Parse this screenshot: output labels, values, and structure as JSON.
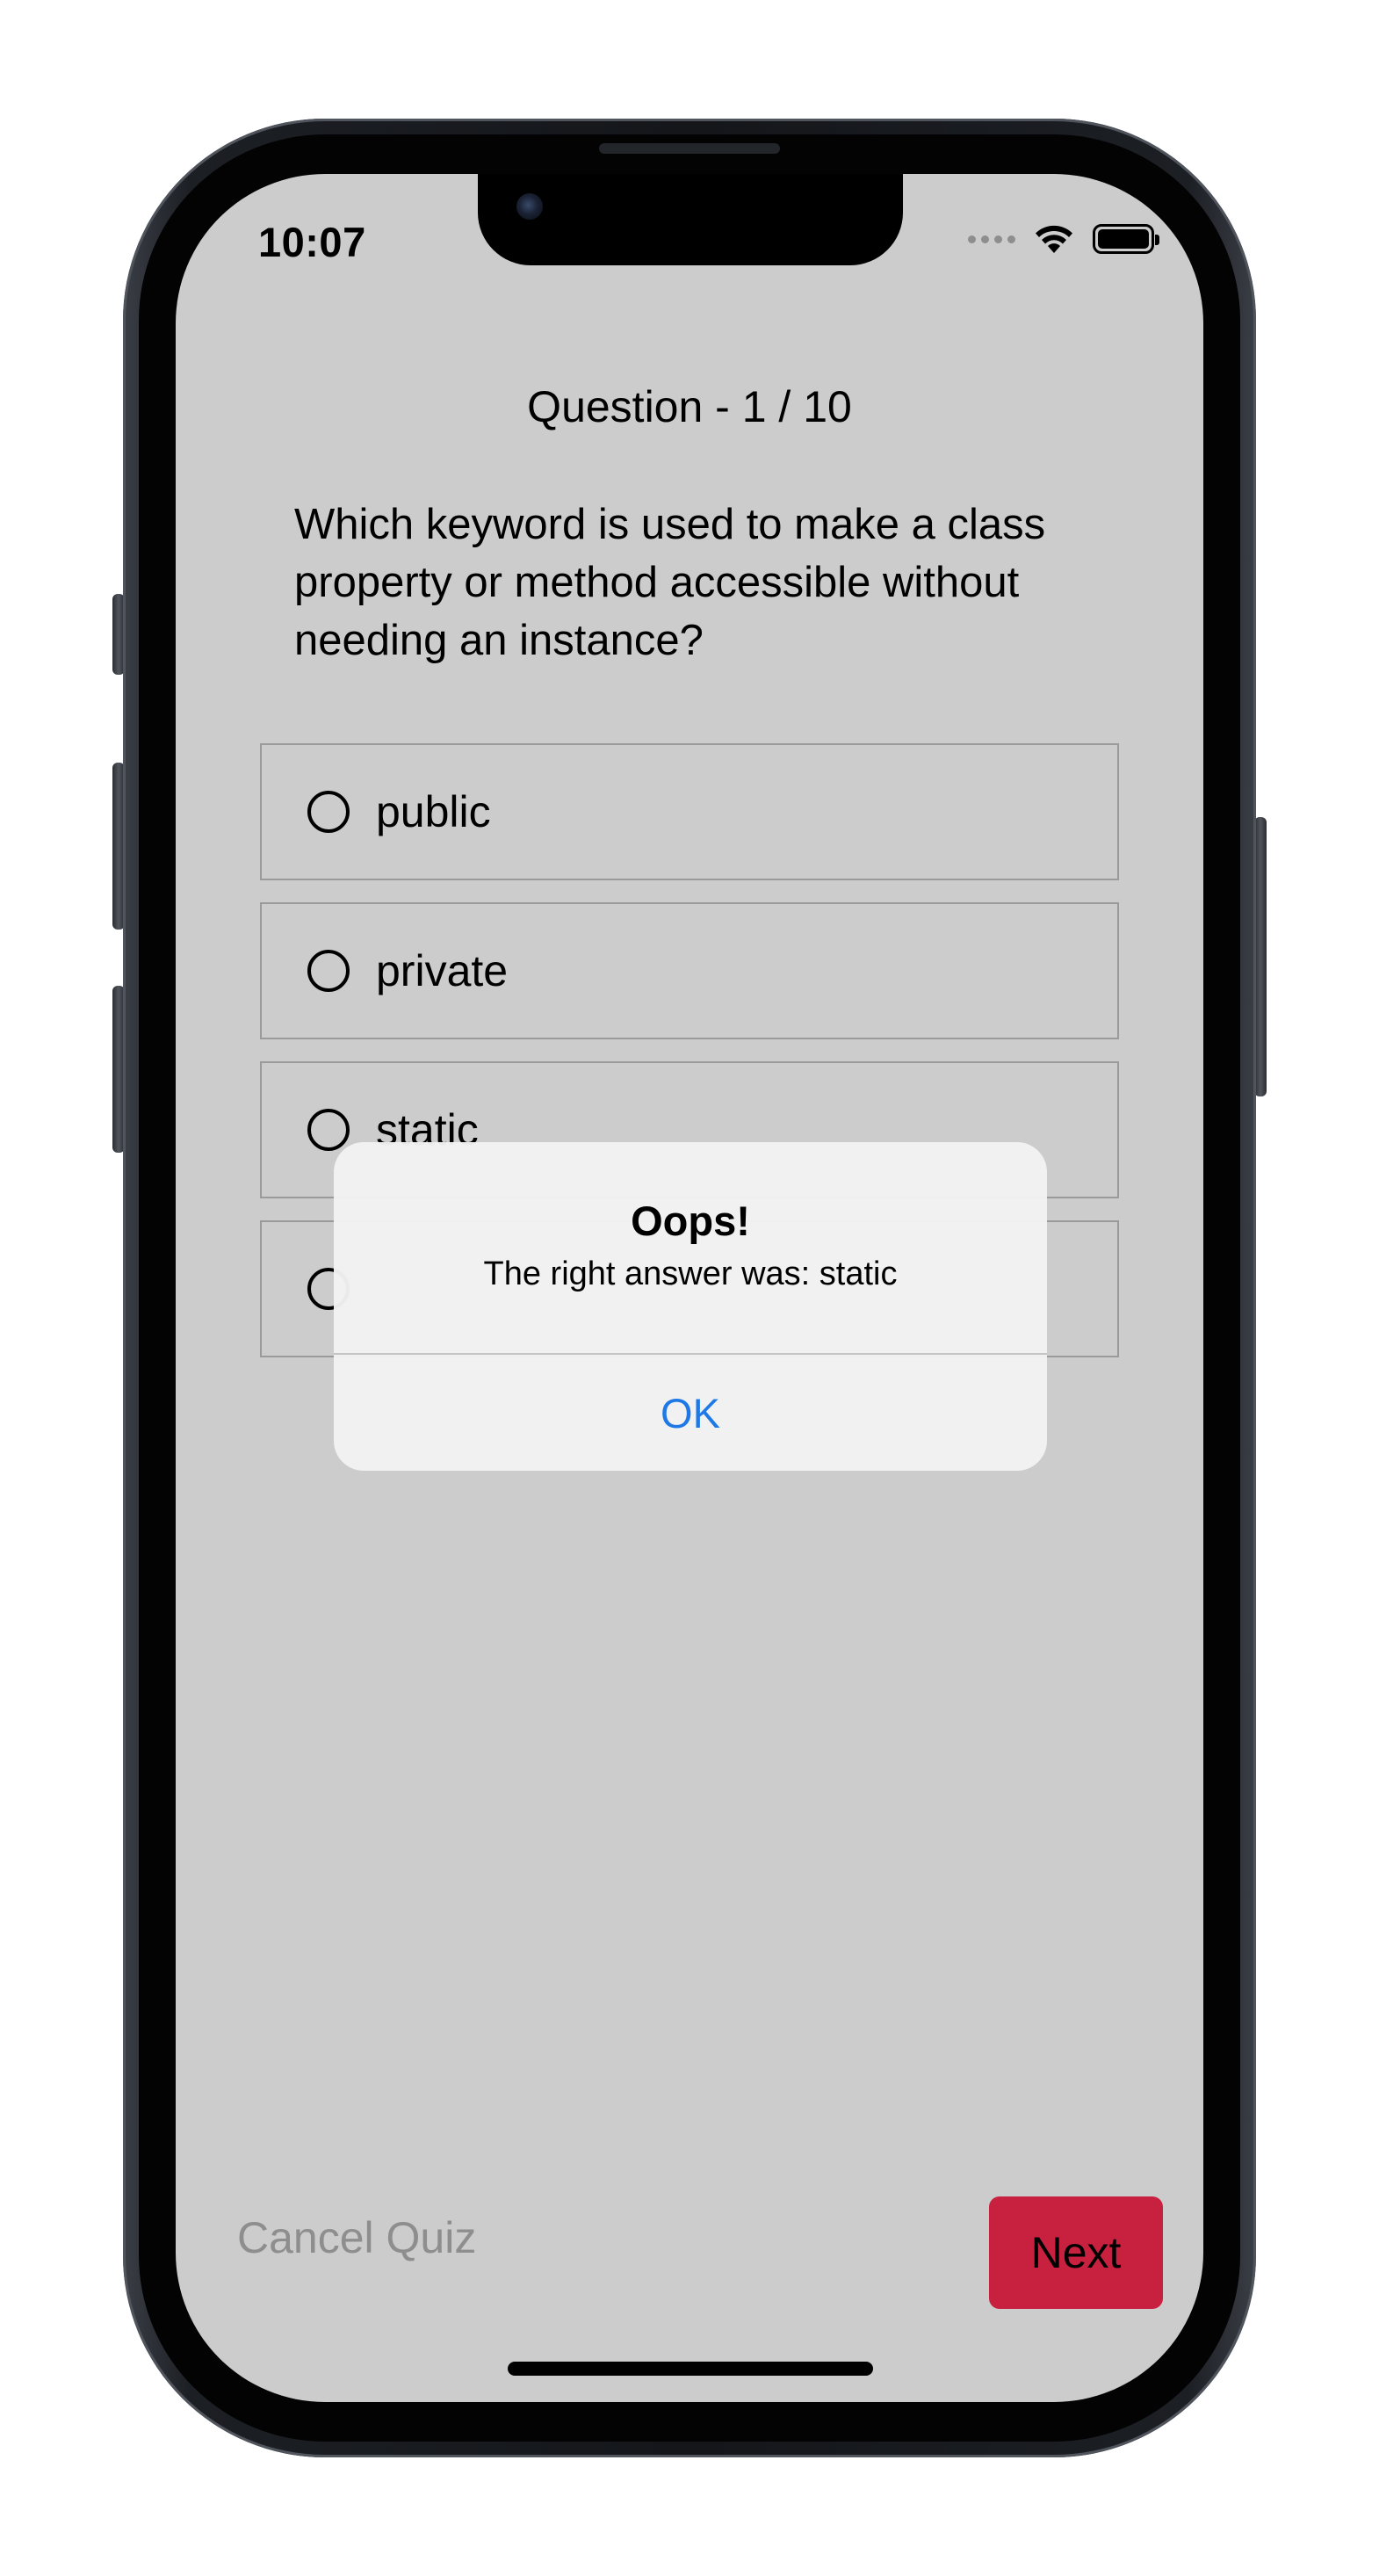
{
  "status_bar": {
    "time": "10:07"
  },
  "quiz": {
    "progress_label": "Question - 1 / 10",
    "question": "Which keyword is used to make a class property or method accessible without needing an instance?",
    "options": [
      {
        "label": "public"
      },
      {
        "label": "private"
      },
      {
        "label": "static"
      },
      {
        "label": ""
      }
    ]
  },
  "footer": {
    "cancel_label": "Cancel Quiz",
    "next_label": "Next"
  },
  "alert": {
    "title": "Oops!",
    "message": "The right answer was: static",
    "ok_label": "OK"
  },
  "colors": {
    "screen_background": "#cccccc",
    "next_button": "#c8203f",
    "alert_button_text": "#1e79e6",
    "cancel_text": "#8e8e8e"
  },
  "icons": {
    "status": [
      "signal-dots-icon",
      "wifi-icon",
      "battery-icon"
    ],
    "option_marker": "radio-unchecked-icon"
  }
}
